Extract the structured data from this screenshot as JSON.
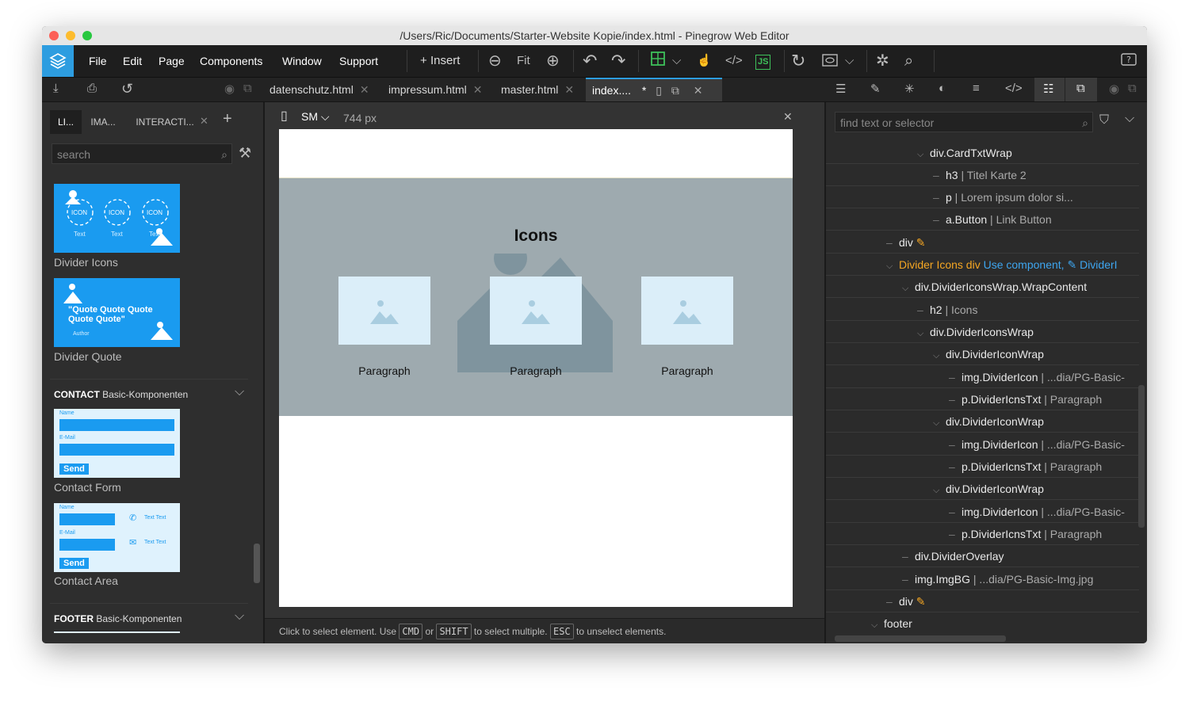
{
  "window": {
    "title": "/Users/Ric/Documents/Starter-Website Kopie/index.html - Pinegrow Web Editor"
  },
  "menu": {
    "items": [
      "File",
      "Edit",
      "Page",
      "Components",
      "Window",
      "Support"
    ],
    "insert_label": "Insert",
    "fit_label": "Fit",
    "js_label": "JS"
  },
  "tabs": [
    {
      "label": "datenschutz.html"
    },
    {
      "label": "impressum.html"
    },
    {
      "label": "master.html"
    },
    {
      "label": "index....",
      "modified": "*"
    }
  ],
  "left_panel": {
    "tabs": [
      "LI...",
      "IMA...",
      "INTERACTI..."
    ],
    "search_placeholder": "search",
    "components": [
      {
        "label": "Divider Icons",
        "icon_texts": [
          "ICON",
          "ICON",
          "ICON"
        ],
        "caption_texts": [
          "Text",
          "Text",
          "Text"
        ]
      },
      {
        "label": "Divider Quote",
        "quote": "\"Quote Quote Quote Quote Quote\"",
        "author": "Author"
      }
    ],
    "contact_section": {
      "name": "CONTACT",
      "sub": "Basic-Komponenten"
    },
    "contact_components": [
      {
        "label": "Contact Form",
        "field1": "Name",
        "field2": "E-Mail",
        "button": "Send"
      },
      {
        "label": "Contact Area",
        "field1": "Name",
        "field2": "E-Mail",
        "button": "Send",
        "info1": "Text Text",
        "info2": "Text Text"
      }
    ],
    "footer_section": {
      "name": "FOOTER",
      "sub": "Basic-Komponenten"
    }
  },
  "canvas": {
    "device": "SM",
    "width_label": "744 px",
    "heading": "Icons",
    "paragraphs": [
      "Paragraph",
      "Paragraph",
      "Paragraph"
    ]
  },
  "status": {
    "part1": "Click to select element. Use",
    "key1": "CMD",
    "part2": "or",
    "key2": "SHIFT",
    "part3": "to select multiple.",
    "key3": "ESC",
    "part4": "to unselect elements."
  },
  "tree": {
    "search_placeholder": "find text or selector",
    "rows": [
      {
        "name": "div.CardTxtWrap",
        "detail": ""
      },
      {
        "name": "h3",
        "detail": " | Titel Karte 2"
      },
      {
        "name": "p",
        "detail": " | Lorem ipsum dolor si..."
      },
      {
        "name": "a.Button",
        "detail": " | Link Button"
      },
      {
        "name": "div",
        "detail": ""
      },
      {
        "name": "Divider Icons",
        "detail": " div",
        "link1": "Use component,",
        "link2": "DividerI"
      },
      {
        "name": "div.DividerIconsWrap.WrapContent",
        "detail": ""
      },
      {
        "name": "h2",
        "detail": " | Icons"
      },
      {
        "name": "div.DividerIconsWrap",
        "detail": ""
      },
      {
        "name": "div.DividerIconWrap",
        "detail": ""
      },
      {
        "name": "img.DividerIcon",
        "detail": " | ...dia/PG-Basic-"
      },
      {
        "name": "p.DividerIcnsTxt",
        "detail": " | Paragraph"
      },
      {
        "name": "div.DividerIconWrap",
        "detail": ""
      },
      {
        "name": "img.DividerIcon",
        "detail": " | ...dia/PG-Basic-"
      },
      {
        "name": "p.DividerIcnsTxt",
        "detail": " | Paragraph"
      },
      {
        "name": "div.DividerIconWrap",
        "detail": ""
      },
      {
        "name": "img.DividerIcon",
        "detail": " | ...dia/PG-Basic-"
      },
      {
        "name": "p.DividerIcnsTxt",
        "detail": " | Paragraph"
      },
      {
        "name": "div.DividerOverlay",
        "detail": ""
      },
      {
        "name": "img.ImgBG",
        "detail": " | ...dia/PG-Basic-Img.jpg"
      },
      {
        "name": "div",
        "detail": ""
      },
      {
        "name": "footer",
        "detail": ""
      }
    ]
  },
  "colors": {
    "accent": "#2d9de0",
    "highlight": "#f5a623",
    "link": "#3ea6f0"
  }
}
